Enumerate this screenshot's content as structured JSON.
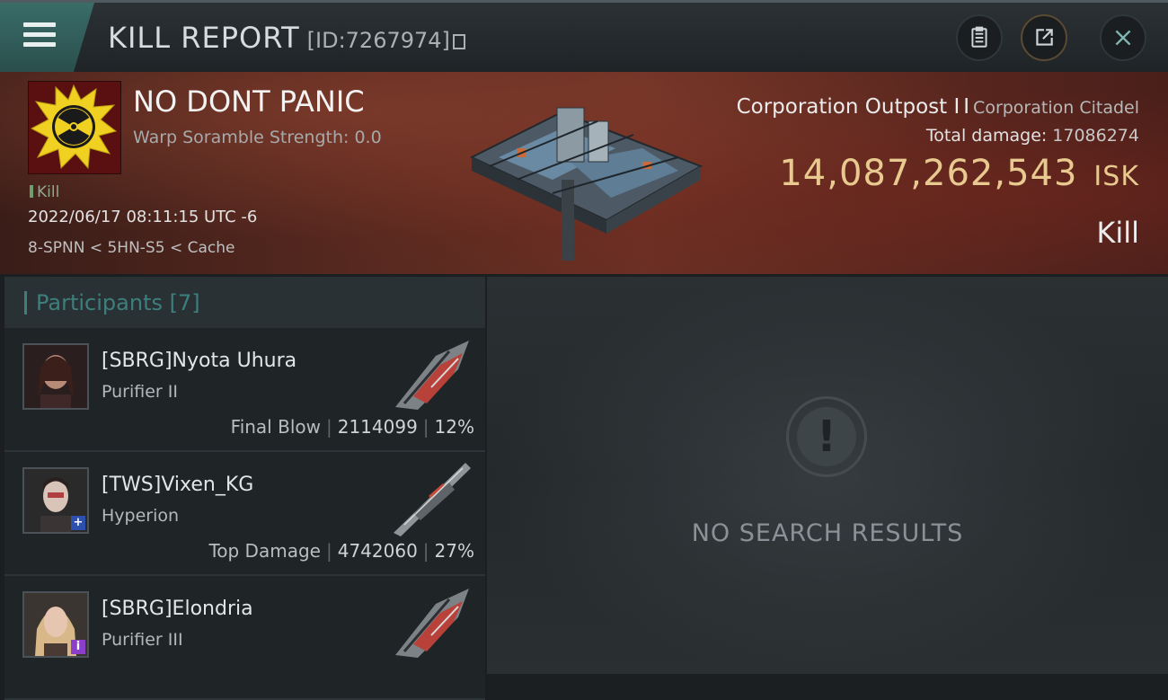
{
  "header": {
    "title": "KILL REPORT",
    "report_id": "[ID:7267974]"
  },
  "icons": {
    "menu": "hamburger-menu-icon",
    "copy": "copy-icon",
    "clipboard": "clipboard-icon",
    "share": "share-icon",
    "close": "close-icon"
  },
  "victim": {
    "name": "NO DONT PANIC",
    "warp_scramble": "Warp Soramble Strength: 0.0",
    "kill_tag": "Kill",
    "datetime": "2022/06/17 08:11:15 UTC -6",
    "location": "8-SPNN < 5HN-S5 < Cache"
  },
  "target": {
    "structure_name": "Corporation Outpost I",
    "separator": "I",
    "structure_class": "Corporation Citadel",
    "total_damage_label": "Total damage:",
    "total_damage_value": "17086274",
    "isk_value": "14,087,262,543",
    "isk_unit": "ISK",
    "result": "Kill"
  },
  "participants": {
    "label": "Participants",
    "count": "[7]",
    "rows": [
      {
        "name": "[SBRG]Nyota Uhura",
        "ship": "Purifier II",
        "role": "Final Blow",
        "damage": "2114099",
        "percent": "12%",
        "badge": ""
      },
      {
        "name": "[TWS]Vixen_KG",
        "ship": "Hyperion",
        "role": "Top Damage",
        "damage": "4742060",
        "percent": "27%",
        "badge": "+"
      },
      {
        "name": "[SBRG]Elondria",
        "ship": "Purifier III",
        "role": "",
        "damage": "",
        "percent": "",
        "badge": "i"
      }
    ]
  },
  "results": {
    "empty_message": "NO SEARCH RESULTS"
  },
  "colors": {
    "accent_teal": "#3d7f7c",
    "isk_gold": "#e8c98f",
    "badge_blue": "#2d4fb0",
    "badge_purple": "#8b3fc9"
  }
}
